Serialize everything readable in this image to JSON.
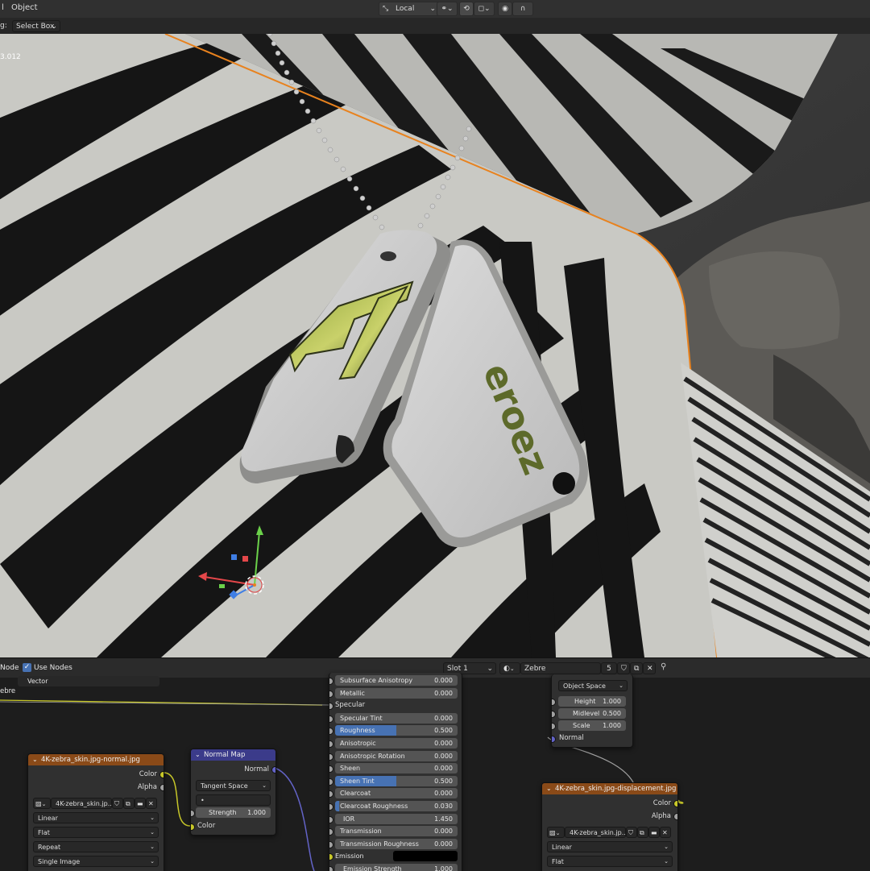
{
  "header": {
    "menu_fragment": "l",
    "menu_object": "Object",
    "transform_orientation": "Local",
    "pivot_caret": "⌄",
    "snap_caret": "⌄"
  },
  "toolbar": {
    "drag_label": "g:",
    "drag_value": "Select Box"
  },
  "viewport": {
    "stat_fragment": "3.012",
    "tag_text": "eroez"
  },
  "node_header": {
    "node_fragment": "Node",
    "use_nodes_label": "Use Nodes",
    "use_nodes_checked": true,
    "slot": "Slot 1",
    "material_name": "Zebre",
    "users_count": "5"
  },
  "left_partial": {
    "vector_label": "Vector",
    "zebre_fragment": "ebre"
  },
  "bsdf": {
    "rows": [
      {
        "label": "Subsurface Anisotropy",
        "value": "0.000",
        "fill": 0
      },
      {
        "label": "Metallic",
        "value": "0.000",
        "fill": 0
      },
      {
        "label": "Specular",
        "value": "",
        "fill": -1
      },
      {
        "label": "Specular Tint",
        "value": "0.000",
        "fill": 0
      },
      {
        "label": "Roughness",
        "value": "0.500",
        "fill": 0.5
      },
      {
        "label": "Anisotropic",
        "value": "0.000",
        "fill": 0
      },
      {
        "label": "Anisotropic Rotation",
        "value": "0.000",
        "fill": 0
      },
      {
        "label": "Sheen",
        "value": "0.000",
        "fill": 0
      },
      {
        "label": "Sheen Tint",
        "value": "0.500",
        "fill": 0.5
      },
      {
        "label": "Clearcoat",
        "value": "0.000",
        "fill": 0
      },
      {
        "label": "Clearcoat Roughness",
        "value": "0.030",
        "fill": 0.03
      },
      {
        "label": "IOR",
        "value": "1.450",
        "fill": -2
      },
      {
        "label": "Transmission",
        "value": "0.000",
        "fill": 0
      },
      {
        "label": "Transmission Roughness",
        "value": "0.000",
        "fill": 0
      },
      {
        "label": "Emission",
        "value": "",
        "fill": -3
      },
      {
        "label": "Emission Strength",
        "value": "1.000",
        "fill": -2
      }
    ]
  },
  "normal_tex": {
    "title": "4K-zebra_skin.jpg-normal.jpg",
    "out_color": "Color",
    "out_alpha": "Alpha",
    "image_name": "4K-zebra_skin.jp...",
    "interpolation": "Linear",
    "projection": "Flat",
    "extension": "Repeat",
    "source": "Single Image"
  },
  "normal_map": {
    "title": "Normal Map",
    "out_normal": "Normal",
    "space": "Tangent Space",
    "uv_map": "•",
    "strength_label": "Strength",
    "strength_value": "1.000",
    "in_color": "Color"
  },
  "displacement": {
    "space": "Object Space",
    "height_label": "Height",
    "height_value": "1.000",
    "midlevel_label": "Midlevel",
    "midlevel_value": "0.500",
    "scale_label": "Scale",
    "scale_value": "1.000",
    "in_normal": "Normal"
  },
  "disp_tex": {
    "title": "4K-zebra_skin.jpg-displacement.jpg",
    "out_color": "Color",
    "out_alpha": "Alpha",
    "image_name": "4K-zebra_skin.jp...",
    "interpolation": "Linear",
    "projection": "Flat"
  },
  "colors": {
    "texture_header": "#8a4a18",
    "vector_header": "#3b3b8a",
    "selection_outline": "#e8821e",
    "roughness_fill": "#4772b3"
  }
}
